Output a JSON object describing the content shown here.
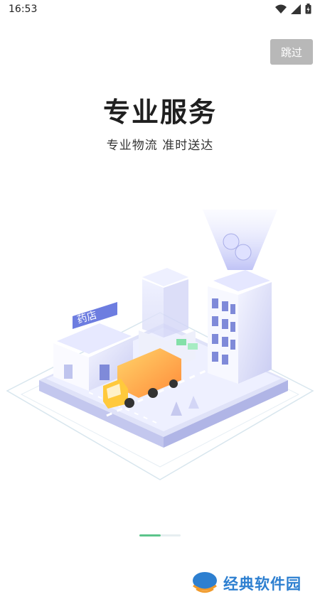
{
  "status_bar": {
    "time": "16:53",
    "icons": [
      "wifi-icon",
      "signal-icon",
      "battery-icon"
    ]
  },
  "onboarding": {
    "skip_label": "跳过",
    "title": "专业服务",
    "subtitle": "专业物流 准时送达",
    "illustration_sign": "药店",
    "page_indicator": {
      "current": 1,
      "total": 2
    }
  },
  "watermark": {
    "text": "经典软件园"
  },
  "colors": {
    "skip_bg": "#b8b8b8",
    "indicator_active": "#5cc48a",
    "indicator_inactive": "#e6eef0",
    "truck": "#f7b733",
    "watermark": "#2d7fd0"
  }
}
